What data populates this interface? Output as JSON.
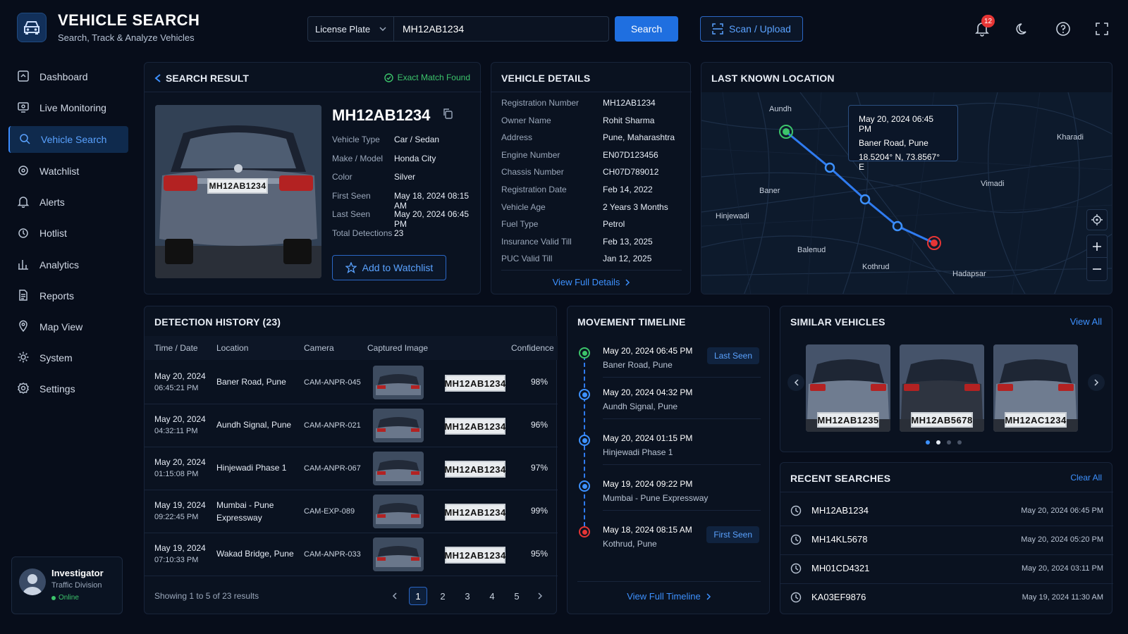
{
  "header": {
    "title": "VEHICLE SEARCH",
    "subtitle": "Search, Track & Analyze Vehicles",
    "search_type": "License Plate",
    "search_value": "MH12AB1234",
    "search_button": "Search",
    "scan_button": "Scan / Upload",
    "notification_count": "12"
  },
  "sidebar": {
    "items": [
      {
        "label": "Dashboard",
        "icon": "dashboard-icon"
      },
      {
        "label": "Live Monitoring",
        "icon": "monitor-icon"
      },
      {
        "label": "Vehicle Search",
        "icon": "search-icon"
      },
      {
        "label": "Watchlist",
        "icon": "gear-badge-icon"
      },
      {
        "label": "Alerts",
        "icon": "bell-icon"
      },
      {
        "label": "Hotlist",
        "icon": "flame-icon"
      },
      {
        "label": "Analytics",
        "icon": "chart-icon"
      },
      {
        "label": "Reports",
        "icon": "document-icon"
      },
      {
        "label": "Map View",
        "icon": "map-pin-icon"
      },
      {
        "label": "System",
        "icon": "cog-icon"
      },
      {
        "label": "Settings",
        "icon": "settings-icon"
      }
    ],
    "active_index": 2
  },
  "user": {
    "name": "Investigator",
    "division": "Traffic Division",
    "status": "Online"
  },
  "search_result": {
    "title": "SEARCH RESULT",
    "match_status": "Exact Match Found",
    "plate": "MH12AB1234",
    "image_plate": "MH12AB1234",
    "fields": [
      {
        "label": "Vehicle Type",
        "value": "Car / Sedan"
      },
      {
        "label": "Make / Model",
        "value": "Honda City"
      },
      {
        "label": "Color",
        "value": "Silver"
      },
      {
        "label": "First Seen",
        "value": "May 18, 2024 08:15 AM"
      },
      {
        "label": "Last Seen",
        "value": "May 20, 2024 06:45 PM"
      },
      {
        "label": "Total Detections",
        "value": "23"
      }
    ],
    "watchlist_button": "Add to Watchlist"
  },
  "vehicle_details": {
    "title": "VEHICLE DETAILS",
    "fields": [
      {
        "label": "Registration Number",
        "value": "MH12AB1234"
      },
      {
        "label": "Owner Name",
        "value": "Rohit Sharma"
      },
      {
        "label": "Address",
        "value": "Pune, Maharashtra"
      },
      {
        "label": "Engine Number",
        "value": "EN07D123456"
      },
      {
        "label": "Chassis Number",
        "value": "CH07D789012"
      },
      {
        "label": "Registration Date",
        "value": "Feb 14, 2022"
      },
      {
        "label": "Vehicle Age",
        "value": "2 Years 3 Months"
      },
      {
        "label": "Fuel Type",
        "value": "Petrol"
      },
      {
        "label": "Insurance Valid Till",
        "value": "Feb 13, 2025"
      },
      {
        "label": "PUC Valid Till",
        "value": "Jan 12, 2025"
      }
    ],
    "link": "View Full Details"
  },
  "last_location": {
    "title": "LAST KNOWN LOCATION",
    "tooltip_time": "May 20, 2024 06:45 PM",
    "tooltip_place": "Baner Road, Pune",
    "tooltip_coords": "18.5204° N, 73.8567° E",
    "places": [
      "Aundh",
      "Kharadi",
      "Baner",
      "Vimadi",
      "Hinjewadi",
      "Baleпud",
      "Kothrud",
      "Hadapsar"
    ]
  },
  "detection_history": {
    "title": "DETECTION HISTORY (23)",
    "columns": [
      "Time / Date",
      "Location",
      "Camera",
      "Captured Image",
      "Confidence"
    ],
    "rows": [
      {
        "date": "May 20, 2024",
        "time": "06:45:21 PM",
        "location": "Baner Road, Pune",
        "location2": "",
        "camera": "CAM-ANPR-045",
        "plate": "MH12AB1234",
        "confidence": "98%"
      },
      {
        "date": "May 20, 2024",
        "time": "04:32:11 PM",
        "location": "Aundh Signal, Pune",
        "location2": "",
        "camera": "CAM-ANPR-021",
        "plate": "MH12AB1234",
        "confidence": "96%"
      },
      {
        "date": "May 20, 2024",
        "time": "01:15:08 PM",
        "location": "Hinjewadi Phase 1",
        "location2": "",
        "camera": "CAM-ANPR-067",
        "plate": "MH12AB1234",
        "confidence": "97%"
      },
      {
        "date": "May 19, 2024",
        "time": "09:22:45 PM",
        "location": "Mumbai - Pune",
        "location2": "Expressway",
        "camera": "CAM-EXP-089",
        "plate": "MH12AB1234",
        "confidence": "99%"
      },
      {
        "date": "May 19, 2024",
        "time": "07:10:33 PM",
        "location": "Wakad Bridge, Pune",
        "location2": "",
        "camera": "CAM-ANPR-033",
        "plate": "MH12AB1234",
        "confidence": "95%"
      }
    ],
    "showing": "Showing 1 to 5 of 23 results",
    "pages": [
      "1",
      "2",
      "3",
      "4",
      "5"
    ]
  },
  "timeline": {
    "title": "MOVEMENT TIMELINE",
    "items": [
      {
        "time": "May 20, 2024 06:45 PM",
        "place": "Baner Road, Pune",
        "tag": "Last Seen"
      },
      {
        "time": "May 20, 2024 04:32 PM",
        "place": "Aundh Signal, Pune",
        "tag": ""
      },
      {
        "time": "May 20, 2024 01:15 PM",
        "place": "Hinjewadi Phase 1",
        "tag": ""
      },
      {
        "time": "May 19, 2024 09:22 PM",
        "place": "Mumbai - Pune Expressway",
        "tag": ""
      },
      {
        "time": "May 18, 2024 08:15 AM",
        "place": "Kothrud, Pune",
        "tag": "First Seen"
      }
    ],
    "link": "View Full Timeline"
  },
  "similar": {
    "title": "SIMILAR VEHICLES",
    "view_all": "View All",
    "plates": [
      "MH12AB1235",
      "MH12AB5678",
      "MH12AC1234"
    ]
  },
  "recent": {
    "title": "RECENT SEARCHES",
    "clear": "Clear All",
    "items": [
      {
        "plate": "MH12AB1234",
        "time": "May 20, 2024 06:45 PM"
      },
      {
        "plate": "MH14KL5678",
        "time": "May 20, 2024 05:20 PM"
      },
      {
        "plate": "MH01CD4321",
        "time": "May 20, 2024 03:11 PM"
      },
      {
        "plate": "KA03EF9876",
        "time": "May 19, 2024 11:30 AM"
      }
    ]
  },
  "colors": {
    "accent": "#1f6fe0",
    "background": "#070d1a",
    "panel": "#0a1220",
    "success": "#3cc46b",
    "danger": "#e63535"
  }
}
